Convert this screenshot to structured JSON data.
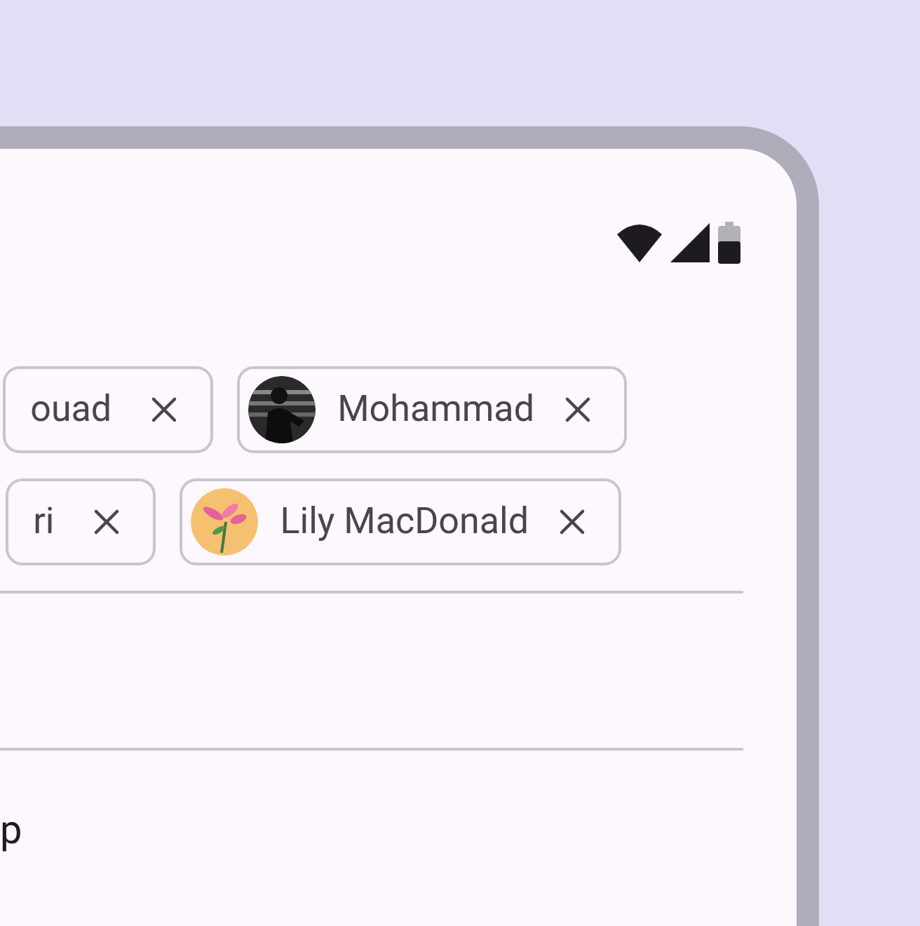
{
  "chip_rows": [
    [
      {
        "label": "ouad"
      },
      {
        "label": "Mohammad"
      }
    ],
    [
      {
        "label": "ri"
      },
      {
        "label": "Lily MacDonald"
      }
    ]
  ],
  "body_text": "p"
}
